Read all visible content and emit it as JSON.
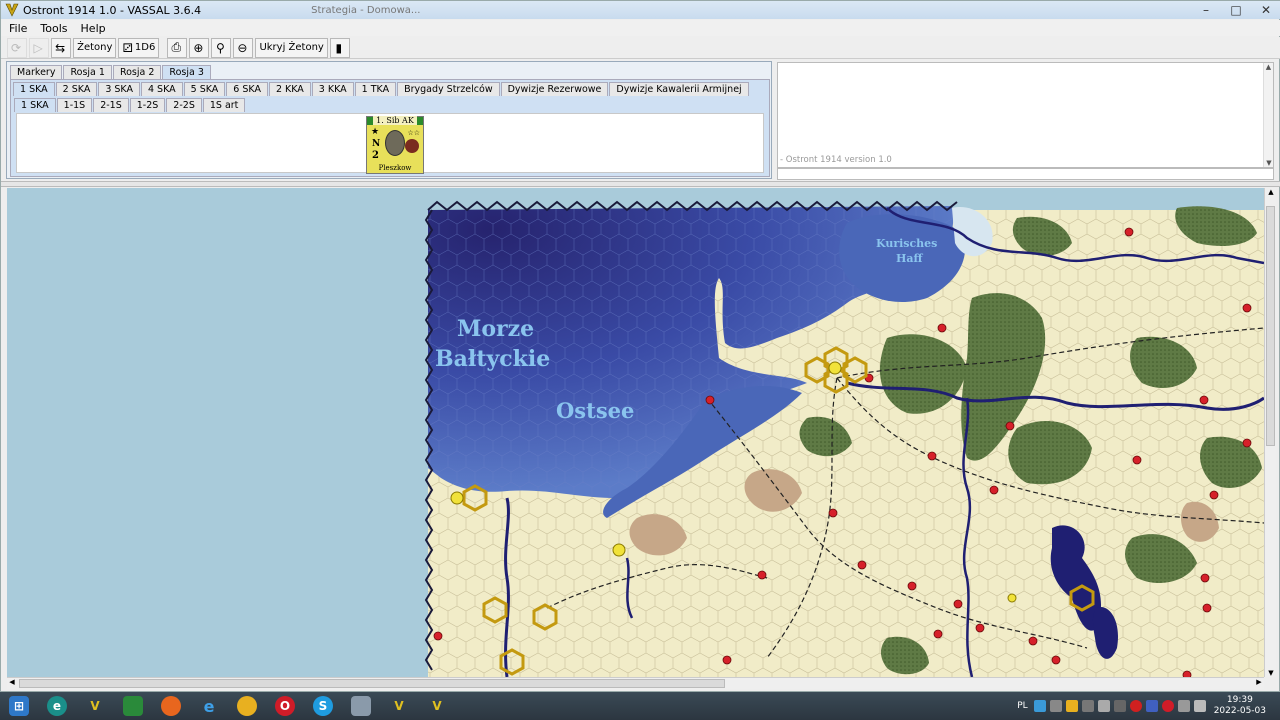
{
  "window": {
    "title": "Ostront 1914 1.0 - VASSAL 3.6.4",
    "ghost_title": "Strategia - Domowa..."
  },
  "menu": [
    "File",
    "Tools",
    "Help"
  ],
  "toolbar": {
    "zetony_label": "Żetony",
    "dice_label": "1D6",
    "hide_label": "Ukryj Żetony"
  },
  "palette": {
    "top_tabs": [
      "Markery",
      "Rosja 1",
      "Rosja 2",
      "Rosja 3"
    ],
    "army_tabs": [
      "1 SKA",
      "2 SKA",
      "3 SKA",
      "4 SKA",
      "5 SKA",
      "6 SKA",
      "2 KKA",
      "3 KKA",
      "1 TKA",
      "Brygady Strzelców",
      "Dywizje Rezerwowe",
      "Dywizje Kawalerii Armijnej"
    ],
    "corps_tabs": [
      "1 SKA",
      "1-1S",
      "2-1S",
      "1-2S",
      "2-2S",
      "1S art"
    ],
    "counter": {
      "header": "1. Sib AK",
      "letter": "N",
      "number": "2",
      "name": "Pleszkow"
    }
  },
  "chat": {
    "message": "- Ostront 1914 version 1.0"
  },
  "map": {
    "sea_label_pl_1": "Morze",
    "sea_label_pl_2": "Bałtyckie",
    "sea_label_de": "Ostsee",
    "haff_label_1": "Kurisches",
    "haff_label_2": "Haff"
  },
  "taskbar": {
    "lang": "PL",
    "time": "19:39",
    "date": "2022-05-03"
  },
  "colors": {
    "sea_dark": "#2a2a78",
    "sea_light": "#5a74c4",
    "land": "#f1ecc8",
    "forest": "#5f7a45",
    "river": "#1f1f72",
    "city": "#d6202a"
  }
}
